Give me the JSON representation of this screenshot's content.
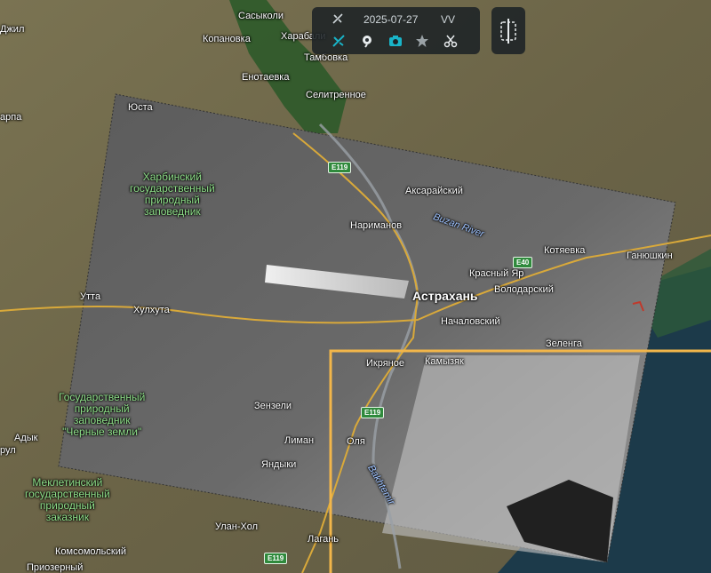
{
  "toolbar": {
    "date": "2025-07-27",
    "polarization": "VV",
    "tools": [
      {
        "icon": "satellite-icon"
      },
      {
        "icon": "measure-icon"
      },
      {
        "icon": "camera-icon"
      },
      {
        "icon": "star-icon"
      },
      {
        "icon": "scissors-icon"
      }
    ],
    "split_icon": "split-view-icon",
    "accent_color": "#19b4c8"
  },
  "map": {
    "places": [
      {
        "name": "Сасыколи"
      },
      {
        "name": "Копановка"
      },
      {
        "name": "Харабали"
      },
      {
        "name": "Тамбовка"
      },
      {
        "name": "Енотаевка"
      },
      {
        "name": "Селитренное"
      },
      {
        "name": "Юста"
      },
      {
        "name": "Аксарайский"
      },
      {
        "name": "Нариманов"
      },
      {
        "name": "Котяевка"
      },
      {
        "name": "Ганюшкин"
      },
      {
        "name": "Красный Яр"
      },
      {
        "name": "Астрахань"
      },
      {
        "name": "Володарский"
      },
      {
        "name": "Утта"
      },
      {
        "name": "Хулхута"
      },
      {
        "name": "Началовский"
      },
      {
        "name": "Зеленга"
      },
      {
        "name": "Икряное"
      },
      {
        "name": "Камызяк"
      },
      {
        "name": "Зензели"
      },
      {
        "name": "Адык"
      },
      {
        "name": "Лиман"
      },
      {
        "name": "Оля"
      },
      {
        "name": "Яндыки"
      },
      {
        "name": "Улан-Хол"
      },
      {
        "name": "Лагань"
      },
      {
        "name": "Комсомольский"
      },
      {
        "name": "Джил"
      },
      {
        "name": "арпа"
      },
      {
        "name": "рул"
      },
      {
        "name": "Приозерный"
      }
    ],
    "reserves": [
      {
        "name": "Харбинский\nгосударственный\nприродный\nзаповедник"
      },
      {
        "name": "Государственный\nприродный\nзаповедник\n\"Черные земли\""
      },
      {
        "name": "Меклетинский\nгосударственный\nприродный\nзаказник"
      }
    ],
    "rivers": [
      {
        "name": "Buzan River"
      },
      {
        "name": "Bakhtemir"
      }
    ],
    "roads": [
      {
        "name": "E119"
      },
      {
        "name": "E119"
      },
      {
        "name": "E40"
      },
      {
        "name": "E119"
      }
    ]
  },
  "colors": {
    "terrain": "#6f6a4e",
    "sar_overlay": "#5a5a5a",
    "selection_box": "#f2b64a",
    "water": "#1c3a4a"
  }
}
